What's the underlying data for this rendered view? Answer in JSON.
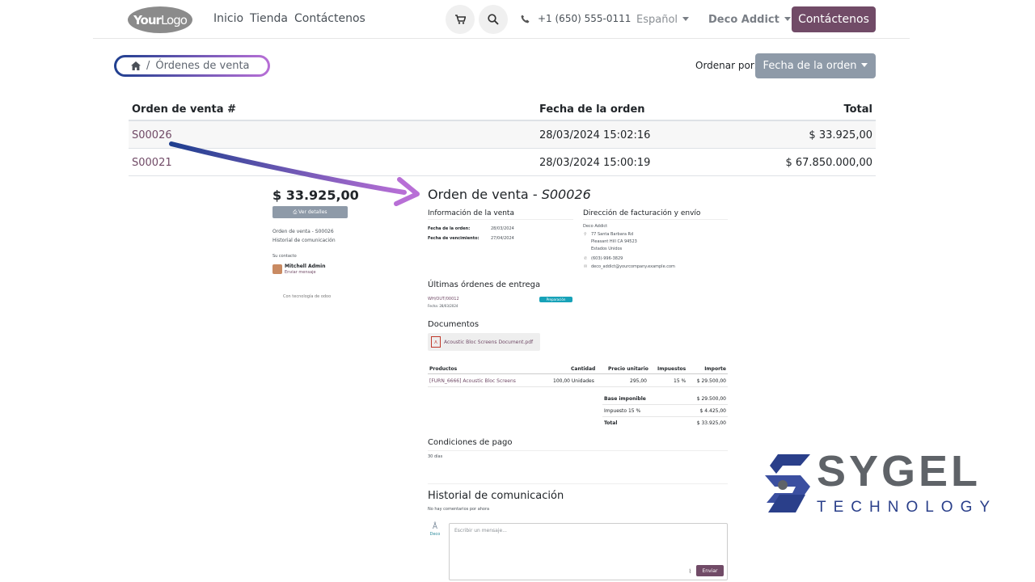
{
  "navbar": {
    "logo_part1": "Your",
    "logo_part2": "Logo",
    "links": [
      "Inicio",
      "Tienda",
      "Contáctenos"
    ],
    "phone": "+1 (650) 555-0111",
    "language": "Español",
    "user": "Deco Addict",
    "cta": "Contáctenos",
    "accent_color": "#714b67"
  },
  "breadcrumb": {
    "home_icon": "home-icon",
    "sep": "/",
    "current": "Órdenes de venta"
  },
  "sort": {
    "label": "Ordenar por:",
    "value": "Fecha de la orden"
  },
  "orders_table": {
    "headers": [
      "Orden de venta #",
      "Fecha de la orden",
      "Total"
    ],
    "rows": [
      {
        "ref": "S00026",
        "date": "28/03/2024  15:02:16",
        "total": "$ 33.925,00"
      },
      {
        "ref": "S00021",
        "date": "28/03/2024  15:00:19",
        "total": "$ 67.850.000,00"
      }
    ]
  },
  "preview": {
    "side": {
      "total": "$ 33.925,00",
      "view_button": "Ver detalles",
      "link1": "Orden de venta - S00026",
      "link2": "Historial de comunicación",
      "contact_label": "Su contacto",
      "contact_name": "Mitchell Admin",
      "contact_action": "Enviar mensaje",
      "powered": "Con tecnología de odoo"
    },
    "title_prefix": "Orden de venta - ",
    "title_ref": "S00026",
    "sale_info": {
      "heading": "Información de la venta",
      "order_date_label": "Fecha de la orden:",
      "order_date": "28/03/2024",
      "due_date_label": "Fecha de vencimiento:",
      "due_date": "27/04/2024"
    },
    "address": {
      "heading": "Dirección de facturación y envío",
      "name": "Deco Addict",
      "line1": "77 Santa Barbara Rd",
      "line2": "Pleasant Hill CA 94523",
      "line3": "Estados Unidos",
      "phone": "(603)-996-3829",
      "email": "deco_addict@yourcompany.example.com"
    },
    "deliveries": {
      "heading": "Últimas órdenes de entrega",
      "ref": "WH/OUT/00012",
      "date": "Fecha: 28/03/2024",
      "status": "Preparación"
    },
    "documents": {
      "heading": "Documentos",
      "file": "Acoustic Bloc Screens Document.pdf"
    },
    "products": {
      "headers": [
        "Productos",
        "Cantidad",
        "Precio unitario",
        "Impuestos",
        "Importe"
      ],
      "row": [
        "[FURN_6666] Acoustic Bloc Screens",
        "100,00 Unidades",
        "295,00",
        "15 %",
        "$ 29.500,00"
      ]
    },
    "totals": [
      {
        "label": "Base imponible",
        "value": "$ 29.500,00"
      },
      {
        "label": "Impuesto 15 %",
        "value": "$ 4.425,00"
      },
      {
        "label": "Total",
        "value": "$ 33.925,00"
      }
    ],
    "payment": {
      "heading": "Condiciones de pago",
      "value": "30 días"
    },
    "history": {
      "heading": "Historial de comunicación",
      "empty": "No hay comentarios por ahora",
      "placeholder": "Escribir un mensaje...",
      "send": "Enviar",
      "avatar_label": "Deco"
    }
  },
  "brand": {
    "name": "SYGEL",
    "sub": "TECHNOLOGY",
    "colors": [
      "#2a3f8a",
      "#5f6368"
    ]
  }
}
